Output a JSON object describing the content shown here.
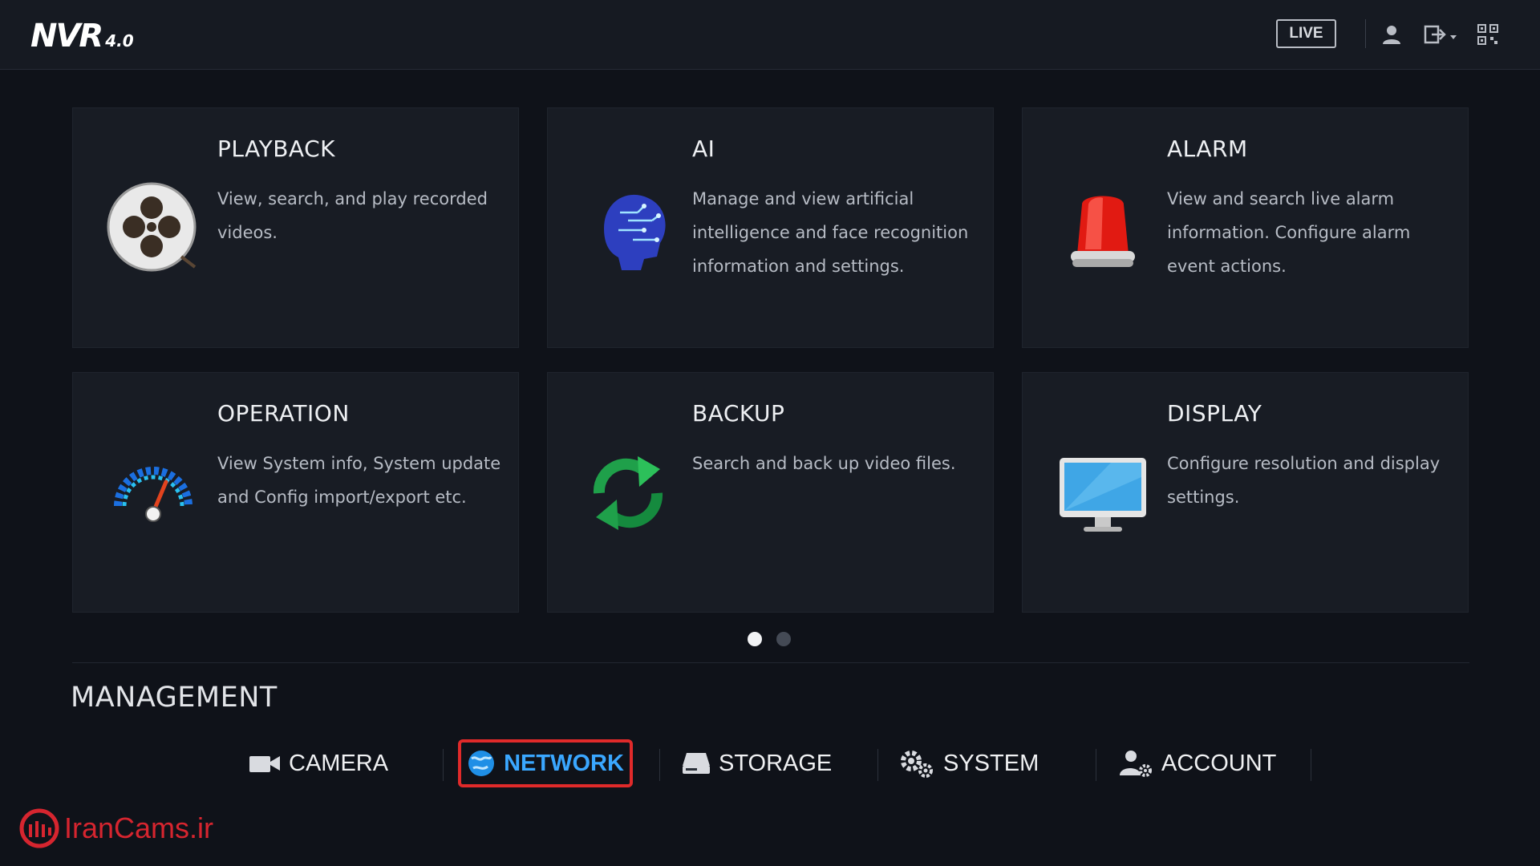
{
  "header": {
    "logo_main": "NVR",
    "logo_version": "4.0",
    "live_label": "LIVE",
    "icons": [
      "user-icon",
      "logout-icon",
      "qr-code-icon"
    ]
  },
  "tiles": [
    {
      "title": "PLAYBACK",
      "description": "View, search, and play recorded videos.",
      "icon": "film-reel-icon"
    },
    {
      "title": "AI",
      "description": "Manage and view artificial intelligence and face recognition information and settings.",
      "icon": "ai-head-icon"
    },
    {
      "title": "ALARM",
      "description": "View and search live alarm information. Configure alarm event actions.",
      "icon": "alarm-siren-icon"
    },
    {
      "title": "OPERATION",
      "description": "View System info, System update and Config import/export etc.",
      "icon": "speedometer-icon"
    },
    {
      "title": "BACKUP",
      "description": "Search and back up video files.",
      "icon": "refresh-icon"
    },
    {
      "title": "DISPLAY",
      "description": "Configure resolution and display settings.",
      "icon": "monitor-icon"
    }
  ],
  "pager": {
    "pages": 2,
    "current": 1
  },
  "management": {
    "title": "MANAGEMENT",
    "items": [
      {
        "label": "CAMERA",
        "icon": "camera-icon"
      },
      {
        "label": "NETWORK",
        "icon": "globe-icon",
        "selected": true
      },
      {
        "label": "STORAGE",
        "icon": "hard-drive-icon"
      },
      {
        "label": "SYSTEM",
        "icon": "gears-icon"
      },
      {
        "label": "ACCOUNT",
        "icon": "user-settings-icon"
      }
    ]
  },
  "brand": {
    "text": "IranCams.ir"
  },
  "colors": {
    "background": "#0f1219",
    "tile": "#181c24",
    "accent_blue": "#3aa7ff",
    "highlight_red": "#e02a2a",
    "brand_red": "#d6252f"
  }
}
